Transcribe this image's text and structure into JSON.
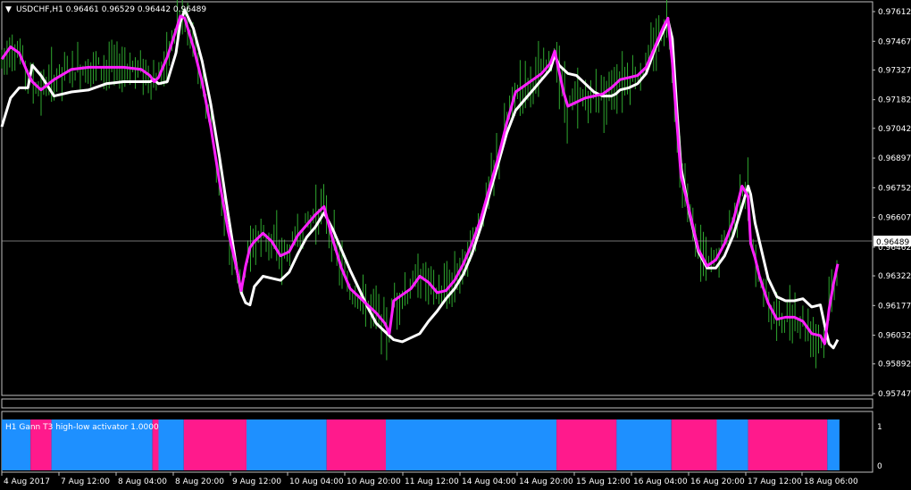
{
  "header": {
    "menu_glyph": "▼",
    "title": "USDCHF,H1  0.96461 0.96529 0.96442 0.96489"
  },
  "indicator": {
    "label": "H1 Gann T3 high-low activator 1.0000",
    "scale_top": "1",
    "scale_bottom": "0",
    "colors": {
      "up": "#1e90ff",
      "down": "#ff1a8c"
    },
    "segments": [
      {
        "state": "up",
        "from": 0,
        "to": 0.033
      },
      {
        "state": "down",
        "from": 0.033,
        "to": 0.057
      },
      {
        "state": "up",
        "from": 0.057,
        "to": 0.173
      },
      {
        "state": "down",
        "from": 0.173,
        "to": 0.18
      },
      {
        "state": "up",
        "from": 0.18,
        "to": 0.209
      },
      {
        "state": "down",
        "from": 0.209,
        "to": 0.281
      },
      {
        "state": "up",
        "from": 0.281,
        "to": 0.373
      },
      {
        "state": "down",
        "from": 0.373,
        "to": 0.441
      },
      {
        "state": "up",
        "from": 0.441,
        "to": 0.637
      },
      {
        "state": "down",
        "from": 0.637,
        "to": 0.706
      },
      {
        "state": "up",
        "from": 0.706,
        "to": 0.769
      },
      {
        "state": "down",
        "from": 0.769,
        "to": 0.821
      },
      {
        "state": "up",
        "from": 0.821,
        "to": 0.857
      },
      {
        "state": "down",
        "from": 0.857,
        "to": 0.948
      },
      {
        "state": "up",
        "from": 0.948,
        "to": 0.962
      }
    ]
  },
  "price_axis": {
    "labels": [
      "0.97612",
      "0.97467",
      "0.97327",
      "0.97182",
      "0.97042",
      "0.96897",
      "0.96752",
      "0.96607",
      "0.96462",
      "0.96322",
      "0.96177",
      "0.96032",
      "0.95892",
      "0.95747"
    ],
    "current_price": "0.96489"
  },
  "time_axis": {
    "labels": [
      "4 Aug 2017",
      "7 Aug 12:00",
      "8 Aug 04:00",
      "8 Aug 20:00",
      "9 Aug 12:00",
      "10 Aug 04:00",
      "10 Aug 20:00",
      "11 Aug 12:00",
      "14 Aug 04:00",
      "14 Aug 20:00",
      "15 Aug 12:00",
      "16 Aug 04:00",
      "16 Aug 20:00",
      "17 Aug 12:00",
      "18 Aug 06:00"
    ]
  },
  "chart_data": {
    "type": "line",
    "symbol": "USDCHF",
    "timeframe": "H1",
    "ylim": [
      0.95747,
      0.97612
    ],
    "colors": {
      "bars": "#2fa82f",
      "slow_line": "#ffffff",
      "fast_line": "#ff20ff"
    },
    "series": [
      {
        "role": "fast",
        "x": [
          0,
          0.01,
          0.02,
          0.03,
          0.035,
          0.045,
          0.06,
          0.08,
          0.1,
          0.12,
          0.14,
          0.16,
          0.17,
          0.175,
          0.18,
          0.19,
          0.2,
          0.205,
          0.21,
          0.22,
          0.23,
          0.24,
          0.25,
          0.26,
          0.27,
          0.275,
          0.28,
          0.285,
          0.29,
          0.3,
          0.31,
          0.32,
          0.33,
          0.34,
          0.35,
          0.36,
          0.37,
          0.38,
          0.39,
          0.4,
          0.41,
          0.42,
          0.43,
          0.44,
          0.445,
          0.45,
          0.46,
          0.47,
          0.48,
          0.49,
          0.5,
          0.51,
          0.52,
          0.53,
          0.54,
          0.55,
          0.56,
          0.57,
          0.58,
          0.59,
          0.6,
          0.61,
          0.62,
          0.63,
          0.635,
          0.64,
          0.645,
          0.65,
          0.66,
          0.67,
          0.68,
          0.69,
          0.7,
          0.705,
          0.71,
          0.72,
          0.73,
          0.74,
          0.75,
          0.76,
          0.765,
          0.77,
          0.775,
          0.78,
          0.79,
          0.8,
          0.81,
          0.82,
          0.83,
          0.84,
          0.85,
          0.857,
          0.86,
          0.865,
          0.87,
          0.88,
          0.89,
          0.9,
          0.91,
          0.92,
          0.93,
          0.94,
          0.945,
          0.95,
          0.955,
          0.96
        ],
        "y": [
          0.9738,
          0.9744,
          0.9741,
          0.9731,
          0.9727,
          0.9723,
          0.9728,
          0.9733,
          0.9734,
          0.9734,
          0.9734,
          0.9733,
          0.973,
          0.9727,
          0.9729,
          0.9739,
          0.9752,
          0.9759,
          0.9758,
          0.9744,
          0.9727,
          0.9705,
          0.9678,
          0.9654,
          0.9635,
          0.9625,
          0.9637,
          0.9646,
          0.9649,
          0.9653,
          0.9649,
          0.9642,
          0.9644,
          0.9652,
          0.9657,
          0.9662,
          0.9666,
          0.965,
          0.9636,
          0.9626,
          0.9622,
          0.9618,
          0.9614,
          0.9609,
          0.9604,
          0.962,
          0.9623,
          0.9626,
          0.9632,
          0.9629,
          0.9624,
          0.9625,
          0.963,
          0.9638,
          0.9648,
          0.966,
          0.9675,
          0.969,
          0.9707,
          0.9722,
          0.9725,
          0.9728,
          0.9731,
          0.9736,
          0.9742,
          0.9732,
          0.9722,
          0.9715,
          0.9717,
          0.9719,
          0.972,
          0.9721,
          0.9724,
          0.9726,
          0.9728,
          0.9729,
          0.973,
          0.9734,
          0.9744,
          0.9754,
          0.9758,
          0.9736,
          0.9708,
          0.9681,
          0.9663,
          0.9645,
          0.9637,
          0.964,
          0.9648,
          0.9659,
          0.9676,
          0.9671,
          0.9648,
          0.9641,
          0.9632,
          0.9619,
          0.9611,
          0.9612,
          0.9612,
          0.961,
          0.9604,
          0.9603,
          0.9599,
          0.9616,
          0.9628,
          0.9638
        ]
      },
      {
        "role": "slow",
        "x": [
          0,
          0.01,
          0.02,
          0.03,
          0.035,
          0.045,
          0.06,
          0.08,
          0.1,
          0.12,
          0.14,
          0.16,
          0.17,
          0.175,
          0.18,
          0.19,
          0.2,
          0.205,
          0.21,
          0.22,
          0.23,
          0.24,
          0.25,
          0.26,
          0.27,
          0.275,
          0.28,
          0.285,
          0.29,
          0.3,
          0.31,
          0.32,
          0.33,
          0.34,
          0.35,
          0.36,
          0.37,
          0.38,
          0.39,
          0.4,
          0.41,
          0.42,
          0.43,
          0.44,
          0.445,
          0.45,
          0.46,
          0.47,
          0.48,
          0.49,
          0.5,
          0.51,
          0.52,
          0.53,
          0.54,
          0.55,
          0.56,
          0.57,
          0.58,
          0.59,
          0.6,
          0.61,
          0.62,
          0.63,
          0.635,
          0.64,
          0.645,
          0.65,
          0.66,
          0.67,
          0.68,
          0.69,
          0.7,
          0.705,
          0.71,
          0.72,
          0.73,
          0.74,
          0.75,
          0.76,
          0.765,
          0.77,
          0.775,
          0.78,
          0.79,
          0.8,
          0.81,
          0.82,
          0.83,
          0.84,
          0.85,
          0.857,
          0.86,
          0.865,
          0.87,
          0.88,
          0.89,
          0.9,
          0.91,
          0.92,
          0.93,
          0.94,
          0.945,
          0.95,
          0.955,
          0.96
        ],
        "y": [
          0.9705,
          0.9719,
          0.9724,
          0.9724,
          0.9735,
          0.973,
          0.972,
          0.9722,
          0.9723,
          0.9726,
          0.9727,
          0.9727,
          0.9727,
          0.9728,
          0.9726,
          0.9727,
          0.9741,
          0.9756,
          0.9762,
          0.9753,
          0.9737,
          0.9716,
          0.969,
          0.9662,
          0.9635,
          0.9624,
          0.9619,
          0.9618,
          0.9627,
          0.9632,
          0.9631,
          0.963,
          0.9634,
          0.9643,
          0.9651,
          0.9656,
          0.9663,
          0.9655,
          0.9645,
          0.9635,
          0.9626,
          0.9617,
          0.9609,
          0.9605,
          0.9603,
          0.9601,
          0.96,
          0.9602,
          0.9604,
          0.961,
          0.9615,
          0.9621,
          0.9626,
          0.9633,
          0.9643,
          0.9656,
          0.9672,
          0.9687,
          0.9702,
          0.9713,
          0.9718,
          0.9723,
          0.9728,
          0.9733,
          0.974,
          0.9735,
          0.9733,
          0.9731,
          0.973,
          0.9726,
          0.9722,
          0.972,
          0.972,
          0.9721,
          0.9723,
          0.9724,
          0.9726,
          0.9731,
          0.9743,
          0.9752,
          0.9757,
          0.9748,
          0.9715,
          0.9685,
          0.9662,
          0.9644,
          0.9636,
          0.9636,
          0.9642,
          0.9652,
          0.9666,
          0.9676,
          0.9672,
          0.9658,
          0.9649,
          0.9631,
          0.9622,
          0.962,
          0.962,
          0.9621,
          0.9617,
          0.9618,
          0.9608,
          0.9599,
          0.9597,
          0.9601
        ]
      }
    ]
  }
}
